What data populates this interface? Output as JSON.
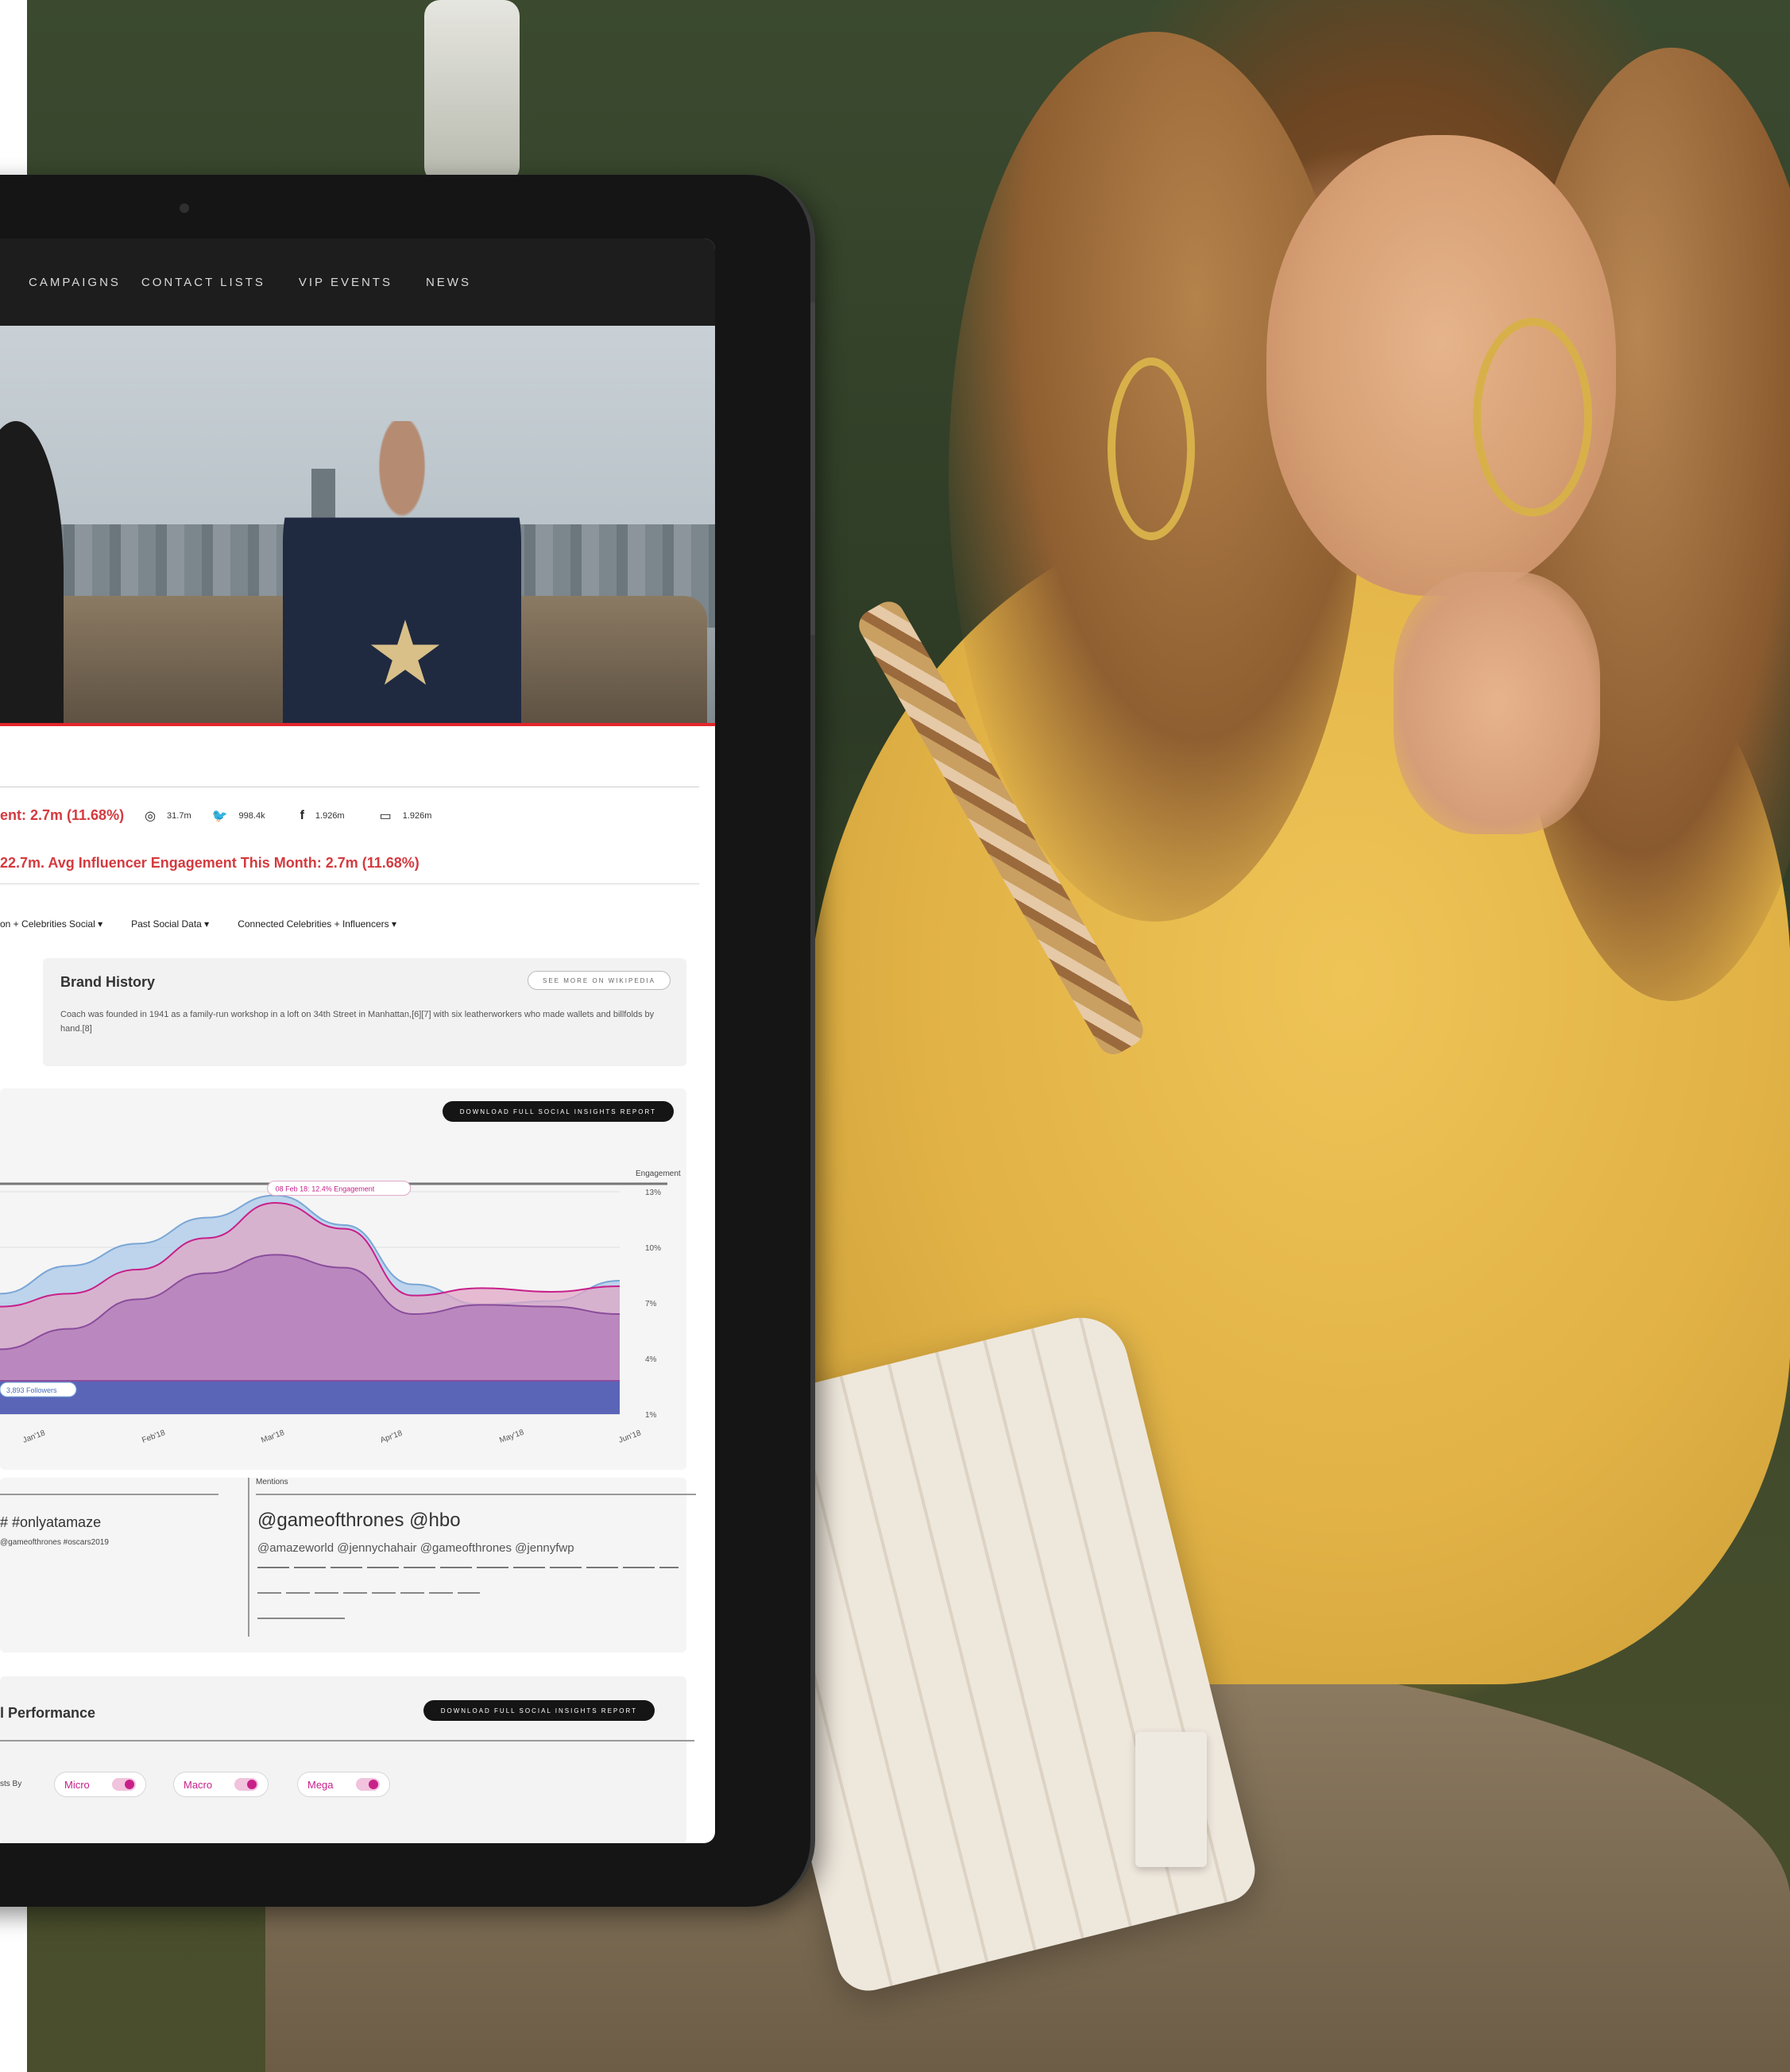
{
  "nav": {
    "items": [
      "CAMPAIGNS",
      "CONTACT LISTS",
      "VIP EVENTS",
      "NEWS"
    ]
  },
  "stats": {
    "engagement": "ent: 2.7m (11.68%)",
    "stats": [
      {
        "icon": "instagram-icon",
        "glyph": "◎",
        "value": "31.7m"
      },
      {
        "icon": "twitter-icon",
        "glyph": "🐦",
        "value": "998.4k"
      },
      {
        "icon": "facebook-icon",
        "glyph": "f",
        "value": "1.926m"
      },
      {
        "icon": "youtube-icon",
        "glyph": "▭",
        "value": "1.926m"
      }
    ],
    "avg_line": "22.7m. Avg Influencer Engagement This Month: 2.7m (11.68%)"
  },
  "filters": [
    "on + Celebrities Social",
    "Past Social Data",
    "Connected Celebrities + Influencers"
  ],
  "brand_history": {
    "title": "Brand History",
    "button": "SEE MORE ON WIKIPEDIA",
    "description": "Coach was founded in 1941 as a family-run workshop in a loft on 34th Street in Manhattan,[6][7] with six leatherworkers who made wallets and billfolds by hand.[8]"
  },
  "chart_section": {
    "download_button": "DOWNLOAD FULL SOCIAL INSIGHTS REPORT",
    "y_axis_label": "Engagement",
    "tooltip": "08 Feb 18: 12.4% Engagement",
    "followers_tag": "3,893 Followers",
    "x_ticks": [
      "Jan'18",
      "Feb'18",
      "Mar'18",
      "Apr'18",
      "May'18",
      "Jun'18"
    ]
  },
  "chart_data": {
    "type": "area",
    "x": [
      0,
      1,
      2,
      3,
      4,
      5,
      6,
      7,
      8,
      9
    ],
    "y_ticks": [
      "13%",
      "10%",
      "7%",
      "4%",
      "1%"
    ],
    "ylim": [
      1,
      13
    ],
    "series": [
      {
        "values": [
          7.5,
          9.0,
          10.2,
          11.6,
          12.8,
          11.2,
          8.0,
          6.9,
          7.1,
          8.2
        ],
        "color": "#a9c8e8"
      },
      {
        "values": [
          6.8,
          7.5,
          8.8,
          10.5,
          12.4,
          11.0,
          7.4,
          7.8,
          7.6,
          7.9
        ],
        "color": "#e0a7c6"
      },
      {
        "values": [
          4.5,
          5.6,
          7.2,
          8.6,
          9.6,
          8.9,
          6.4,
          6.9,
          6.8,
          6.4
        ],
        "color": "#b07ab8"
      },
      {
        "values": [
          2.8,
          2.8,
          2.8,
          2.8,
          2.8,
          2.8,
          2.8,
          2.8,
          2.8,
          2.8
        ],
        "color": "#5a65b8"
      }
    ]
  },
  "bottom": {
    "hashtags_title": "# #onlyatamaze",
    "hashtags_sub": "@gameofthrones #oscars2019",
    "mentions_label": "Mentions",
    "mentions_main": "@gameofthrones @hbo",
    "mentions_sub": "@amazeworld @jennychahair @gameofthrones @jennyfwp"
  },
  "performance": {
    "title": "l Performance",
    "download_button": "DOWNLOAD FULL SOCIAL INSIGHTS REPORT",
    "label": "sts By",
    "pills": [
      "Micro",
      "Macro",
      "Mega"
    ]
  },
  "colors": {
    "accent_red": "#d43a3f",
    "magenta": "#c8208a"
  }
}
